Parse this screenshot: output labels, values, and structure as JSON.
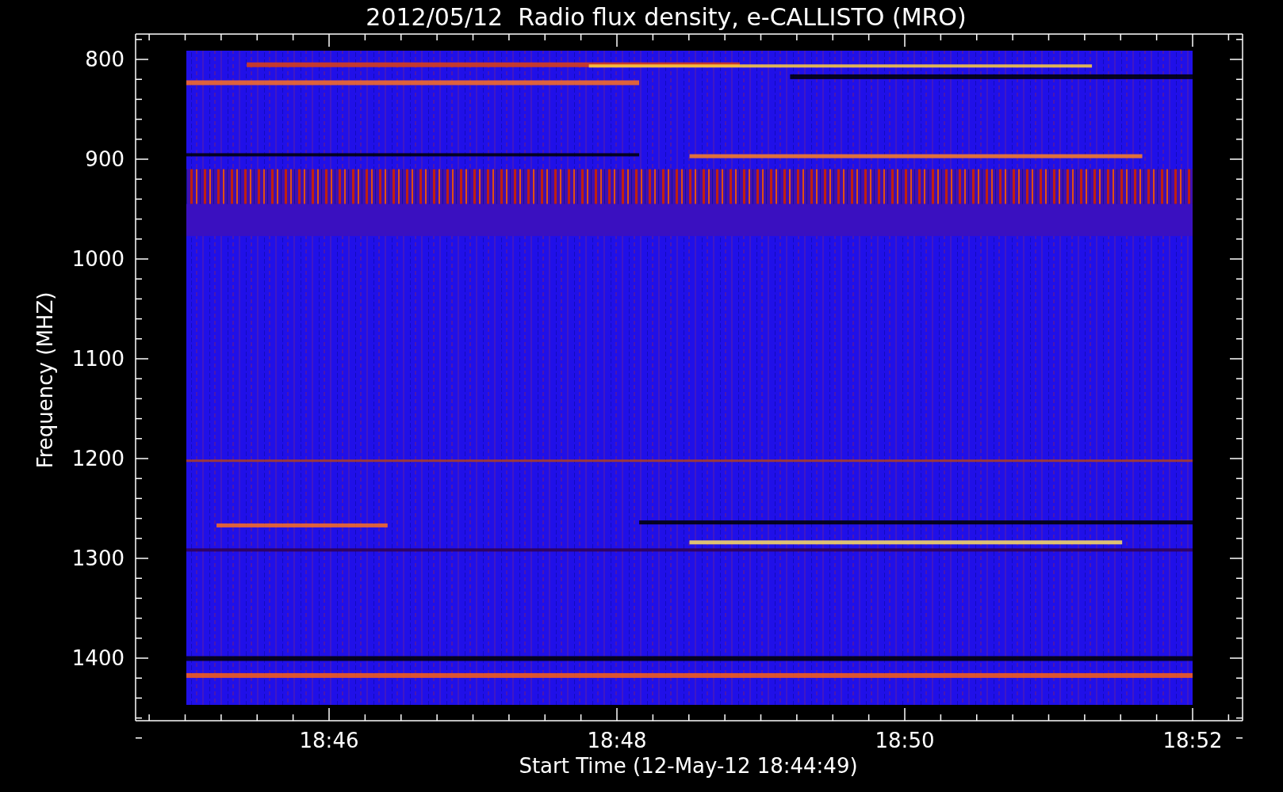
{
  "plot": {
    "title": "2012/05/12  Radio flux density, e-CALLISTO (MRO)",
    "ylabel": "Frequency (MHZ)",
    "xlabel": "Start Time (12-May-12 18:44:49)",
    "yticks": [
      "800",
      "900",
      "1000",
      "1100",
      "1200",
      "1300",
      "1400"
    ],
    "xticks": [
      "18:46",
      "18:48",
      "18:50",
      "18:52"
    ]
  }
}
